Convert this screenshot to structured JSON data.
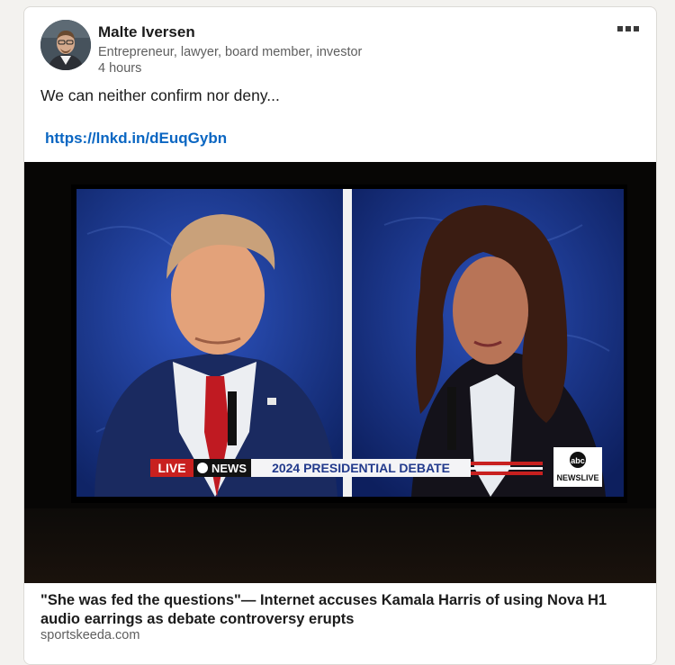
{
  "post": {
    "author": {
      "name": "Malte Iversen",
      "headline": "Entrepreneur, lawyer, board member, investor",
      "time": "4 hours"
    },
    "menu_icon": "ellipsis-icon",
    "text": "We can neither confirm nor deny...",
    "link": "https://lnkd.in/dEuqGybn"
  },
  "media": {
    "ticker": {
      "live": "LIVE",
      "network": "NEWS",
      "headline": "2024 PRESIDENTIAL DEBATE"
    },
    "corner_logo": {
      "brand": "abc",
      "label": "NEWSLIVE"
    }
  },
  "article": {
    "title": "\"She was fed the questions\"— Internet accuses Kamala Harris of using Nova H1 audio earrings as debate controversy erupts",
    "source": "sportskeeda.com"
  },
  "colors": {
    "link": "#0a66c2",
    "ticker_red": "#c8201f",
    "ticker_blue": "#223a8c",
    "studio_blue": "#1e3c96"
  }
}
